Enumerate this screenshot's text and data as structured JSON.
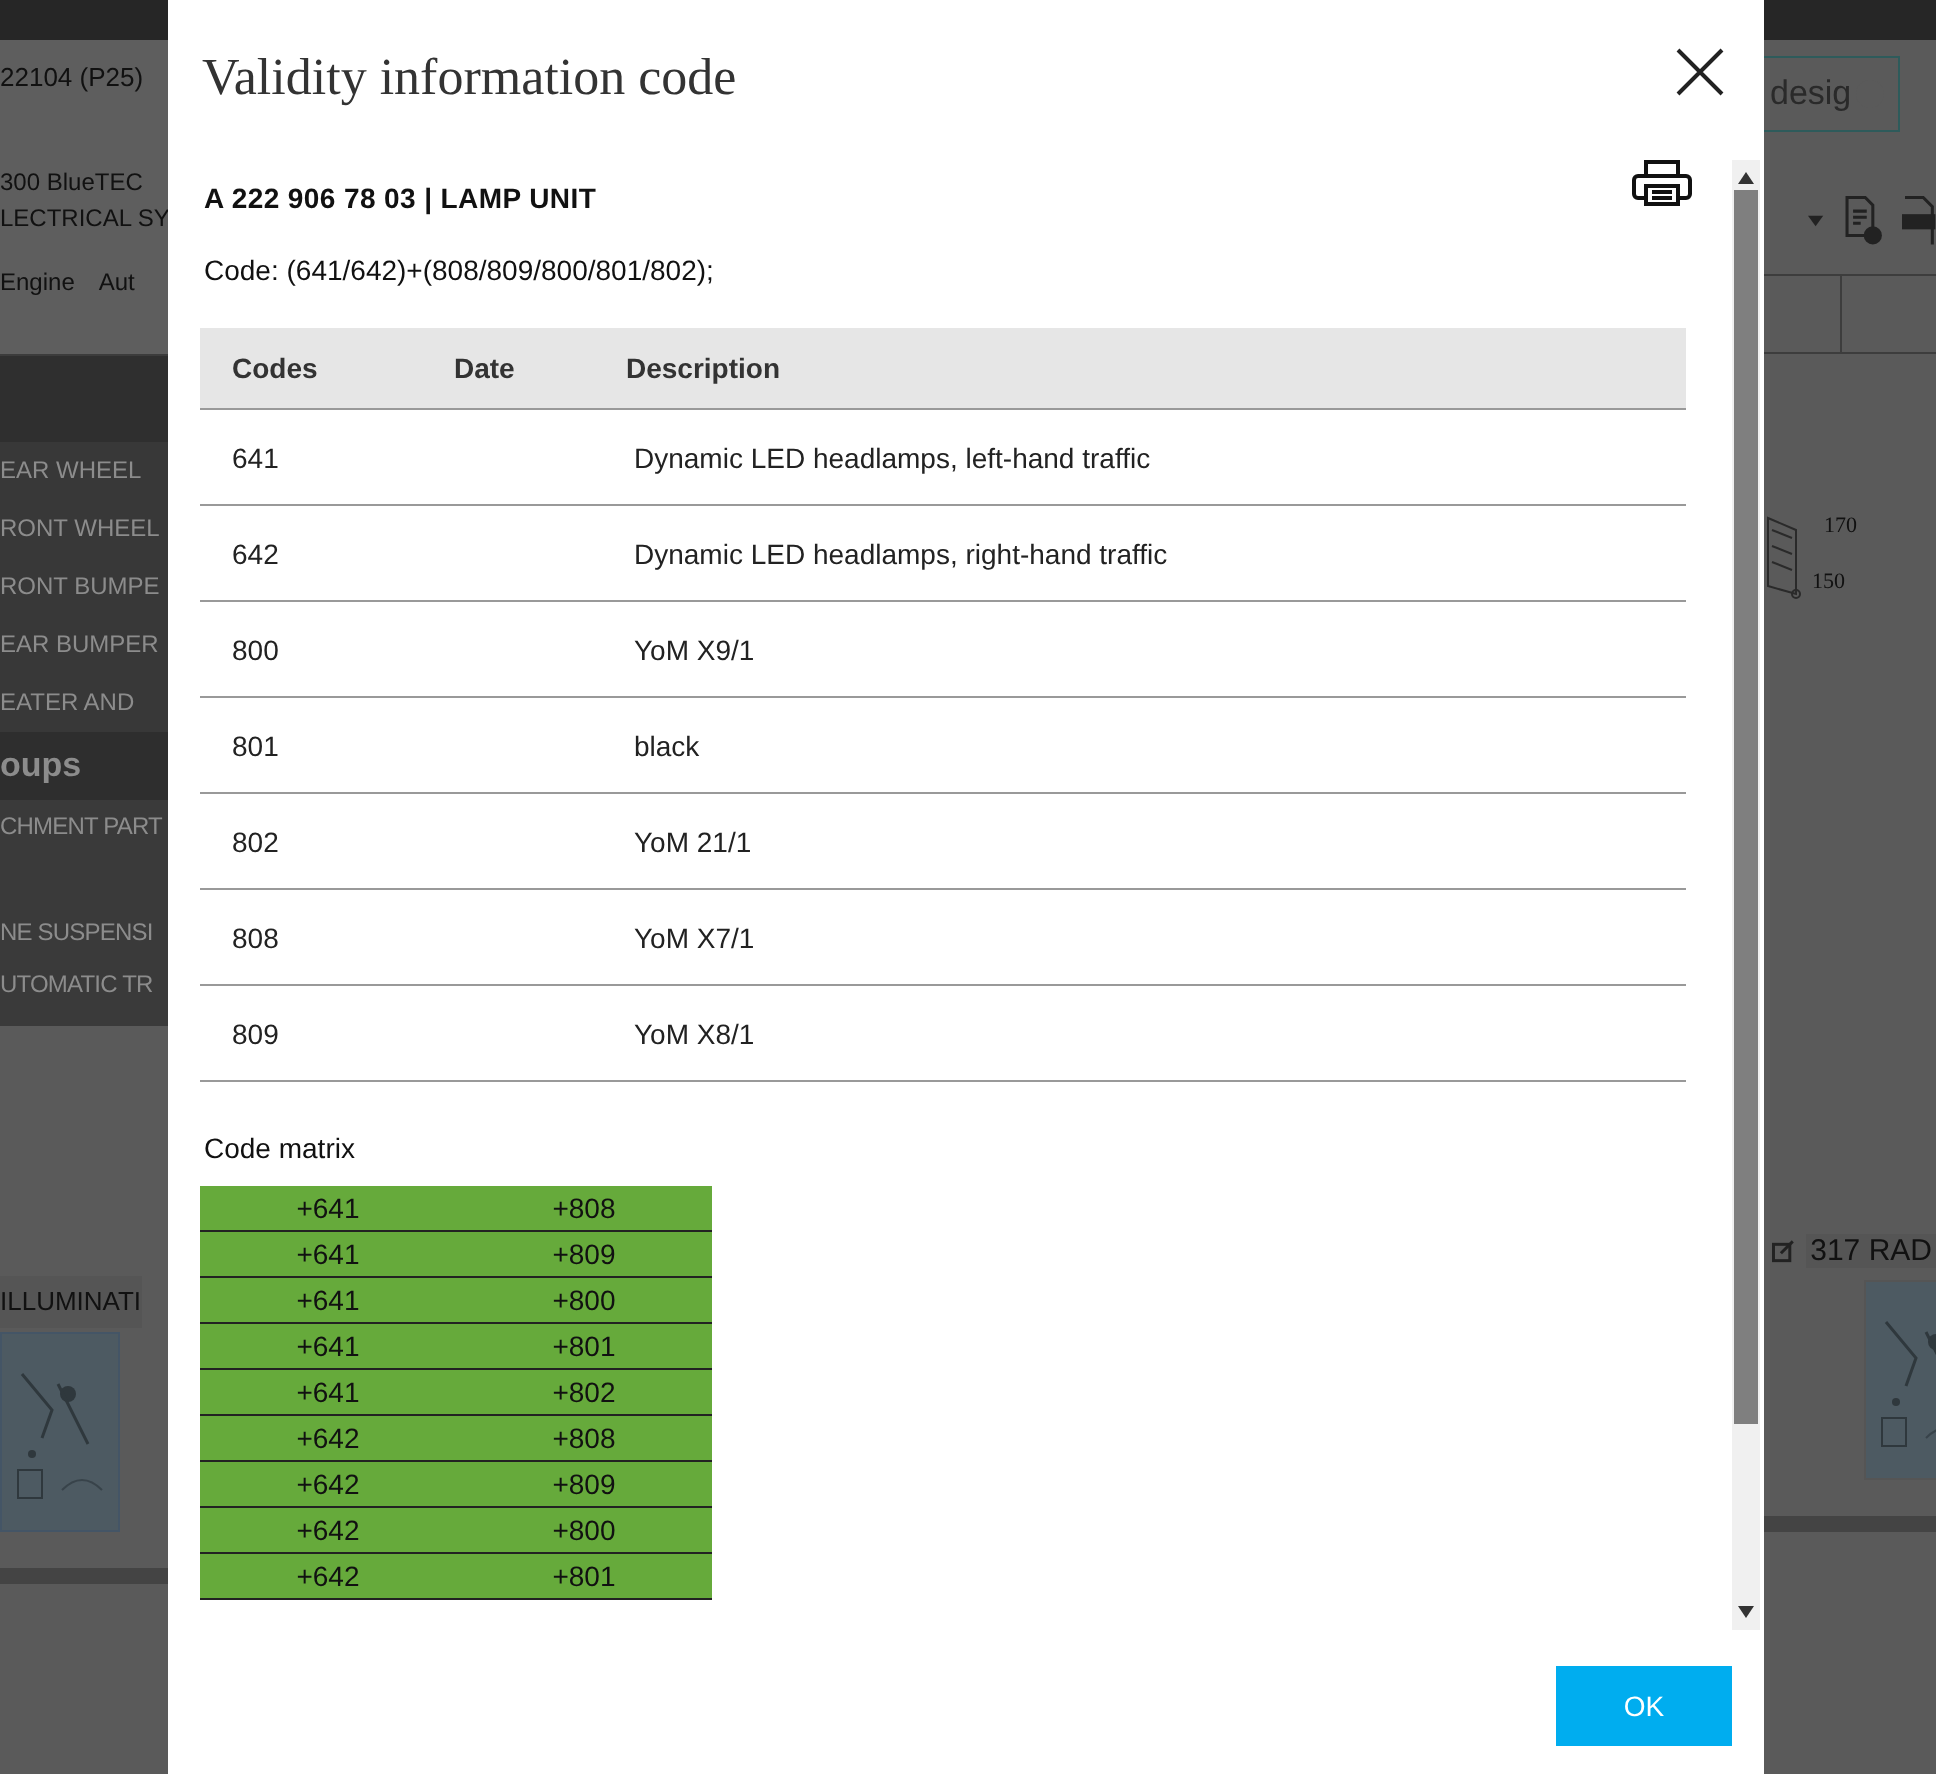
{
  "background": {
    "left": {
      "header": "22104 (P25)",
      "vehicle_lines": [
        "300 BlueTEC",
        "LECTRICAL SY"
      ],
      "tabs": [
        "Engine",
        "Aut"
      ],
      "list_items": [
        "EAR WHEEL",
        "RONT WHEEL",
        "RONT BUMPE",
        "EAR BUMPER",
        "EATER AND"
      ],
      "group_heading": "oups",
      "group_items": [
        "CHMENT PART",
        "NE SUSPENSI",
        "UTOMATIC TR"
      ],
      "tile_title": "ILLUMINATI"
    },
    "right": {
      "button": "desig",
      "callouts": [
        "170",
        "150"
      ],
      "tile_title": "317 RAD"
    }
  },
  "dialog": {
    "title": "Validity information code",
    "part": "A 222 906 78 03 | LAMP UNIT",
    "code_line": "Code: (641/642)+(808/809/800/801/802);",
    "table": {
      "columns": [
        "Codes",
        "Date",
        "Description"
      ],
      "rows": [
        {
          "code": "641",
          "description": "Dynamic LED headlamps, left-hand traffic"
        },
        {
          "code": "642",
          "description": "Dynamic LED headlamps, right-hand traffic"
        },
        {
          "code": "800",
          "description": "YoM X9/1"
        },
        {
          "code": "801",
          "description": "black"
        },
        {
          "code": "802",
          "description": "YoM 21/1"
        },
        {
          "code": "808",
          "description": "YoM X7/1"
        },
        {
          "code": "809",
          "description": "YoM X8/1"
        }
      ]
    },
    "matrix": {
      "label": "Code matrix",
      "rows": [
        [
          "+641",
          "+808"
        ],
        [
          "+641",
          "+809"
        ],
        [
          "+641",
          "+800"
        ],
        [
          "+641",
          "+801"
        ],
        [
          "+641",
          "+802"
        ],
        [
          "+642",
          "+808"
        ],
        [
          "+642",
          "+809"
        ],
        [
          "+642",
          "+800"
        ],
        [
          "+642",
          "+801"
        ]
      ]
    },
    "buttons": [
      "OK"
    ]
  }
}
